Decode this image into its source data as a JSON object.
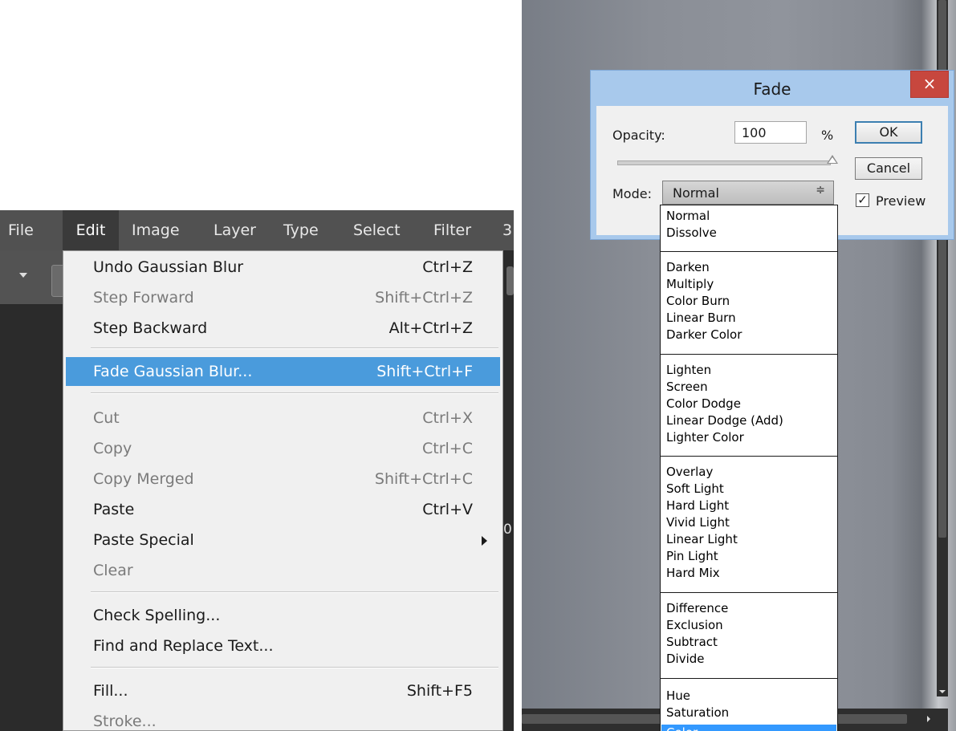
{
  "menubar": {
    "items": [
      "File",
      "Edit",
      "Image",
      "Layer",
      "Type",
      "Select",
      "Filter",
      "3"
    ],
    "active": "Edit"
  },
  "edit_menu": {
    "undo": {
      "label": "Undo Gaussian Blur",
      "shortcut": "Ctrl+Z",
      "enabled": true
    },
    "step_forward": {
      "label": "Step Forward",
      "shortcut": "Shift+Ctrl+Z",
      "enabled": false
    },
    "step_backward": {
      "label": "Step Backward",
      "shortcut": "Alt+Ctrl+Z",
      "enabled": true
    },
    "fade": {
      "label": "Fade Gaussian Blur...",
      "shortcut": "Shift+Ctrl+F",
      "highlighted": true
    },
    "cut": {
      "label": "Cut",
      "shortcut": "Ctrl+X",
      "enabled": false
    },
    "copy": {
      "label": "Copy",
      "shortcut": "Ctrl+C",
      "enabled": false
    },
    "copy_merged": {
      "label": "Copy Merged",
      "shortcut": "Shift+Ctrl+C",
      "enabled": false
    },
    "paste": {
      "label": "Paste",
      "shortcut": "Ctrl+V",
      "enabled": true
    },
    "paste_special": {
      "label": "Paste Special",
      "enabled": true
    },
    "clear": {
      "label": "Clear",
      "enabled": false
    },
    "check_spelling": {
      "label": "Check Spelling...",
      "enabled": true
    },
    "find_replace": {
      "label": "Find and Replace Text...",
      "enabled": true
    },
    "fill": {
      "label": "Fill...",
      "shortcut": "Shift+F5",
      "enabled": true
    },
    "stroke": {
      "label": "Stroke...",
      "enabled": false
    }
  },
  "background_fragment": "0",
  "fade_dialog": {
    "title": "Fade",
    "close_icon": "×",
    "opacity_label": "Opacity:",
    "opacity_value": "100",
    "percent": "%",
    "opacity_fraction": 1.0,
    "mode_label": "Mode:",
    "mode_value": "Normal",
    "ok_label": "OK",
    "cancel_label": "Cancel",
    "preview_label": "Preview",
    "preview_checked": true,
    "check_mark": "✓",
    "select_arrows": "≑"
  },
  "mode_options": {
    "normal": "Normal",
    "dissolve": "Dissolve",
    "darken": "Darken",
    "multiply": "Multiply",
    "color_burn": "Color Burn",
    "linear_burn": "Linear Burn",
    "darker_color": "Darker Color",
    "lighten": "Lighten",
    "screen": "Screen",
    "color_dodge": "Color Dodge",
    "linear_dodge": "Linear Dodge (Add)",
    "lighter_color": "Lighter Color",
    "overlay": "Overlay",
    "soft_light": "Soft Light",
    "hard_light": "Hard Light",
    "vivid_light": "Vivid Light",
    "linear_light": "Linear Light",
    "pin_light": "Pin Light",
    "hard_mix": "Hard Mix",
    "difference": "Difference",
    "exclusion": "Exclusion",
    "subtract": "Subtract",
    "divide": "Divide",
    "hue": "Hue",
    "saturation": "Saturation",
    "color": "Color"
  },
  "colors": {
    "highlight": "#4a9bdc",
    "dialog_frame": "#a8c9ec",
    "close_button": "#c7473e",
    "list_selection": "#3399ff"
  }
}
